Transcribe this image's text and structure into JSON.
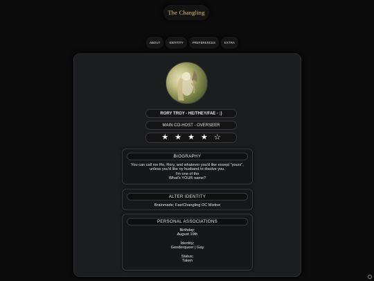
{
  "site": {
    "title": "The Changling"
  },
  "nav": [
    "ABOUT",
    "IDENTITY",
    "PREFERENCES",
    "EXTRA"
  ],
  "profile": {
    "name": "RORY TROY - HE/THEY/FAE - :)",
    "role": "MAIN CO-HOST - OVERSEER",
    "stars": [
      "★",
      "★",
      "★",
      "★",
      "☆"
    ],
    "rating": {
      "filled": 4,
      "total": 5
    }
  },
  "biography": {
    "title": "BIOGRAPHY",
    "lines": [
      "You can call me Ro, Rory, and whatever you'd like except \"yours\",",
      "unless you'd like ny husband to disolve you.",
      "I'm one of the",
      "What's YOUR name?"
    ]
  },
  "alter": {
    "title": "ALTER IDENTITY",
    "text": "Brainmade; Fae/Changling OC Mixtive"
  },
  "associations": {
    "title": "PERSONAL ASSOCIATIONS",
    "groups": [
      {
        "label": "Birthday;",
        "value": "August 19th"
      },
      {
        "label": "Identity;",
        "value": "Genderqueer | Gay"
      },
      {
        "label": "Status;",
        "value": "Taken"
      }
    ]
  },
  "colors": {
    "title_gold": "#e7c56a",
    "panel": "#1c1d1f",
    "page": "#0b0b0c"
  },
  "icons": [
    "avatar-portrait",
    "star-icon",
    "corner-circle-icon"
  ]
}
